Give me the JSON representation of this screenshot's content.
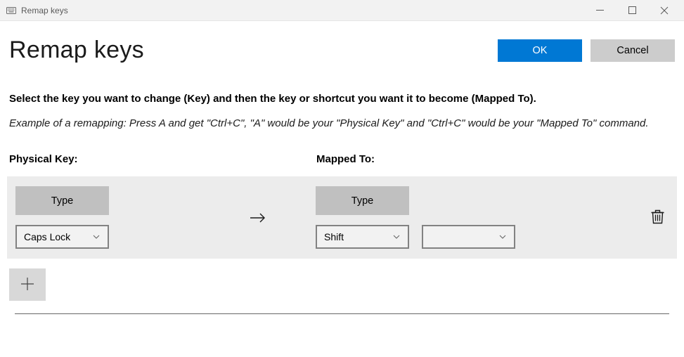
{
  "titlebar": {
    "title": "Remap keys"
  },
  "header": {
    "pageTitle": "Remap keys",
    "okLabel": "OK",
    "cancelLabel": "Cancel"
  },
  "text": {
    "instruction": "Select the key you want to change (Key) and then the key or shortcut you want it to become (Mapped To).",
    "example": "Example of a remapping: Press A and get \"Ctrl+C\", \"A\" would be your \"Physical Key\" and \"Ctrl+C\" would be your \"Mapped To\" command."
  },
  "columns": {
    "physicalKey": "Physical Key:",
    "mappedTo": "Mapped To:"
  },
  "mapping": {
    "typeLabel": "Type",
    "physicalKey": "Caps Lock",
    "mappedToKey": "Shift",
    "mappedToSecond": ""
  }
}
